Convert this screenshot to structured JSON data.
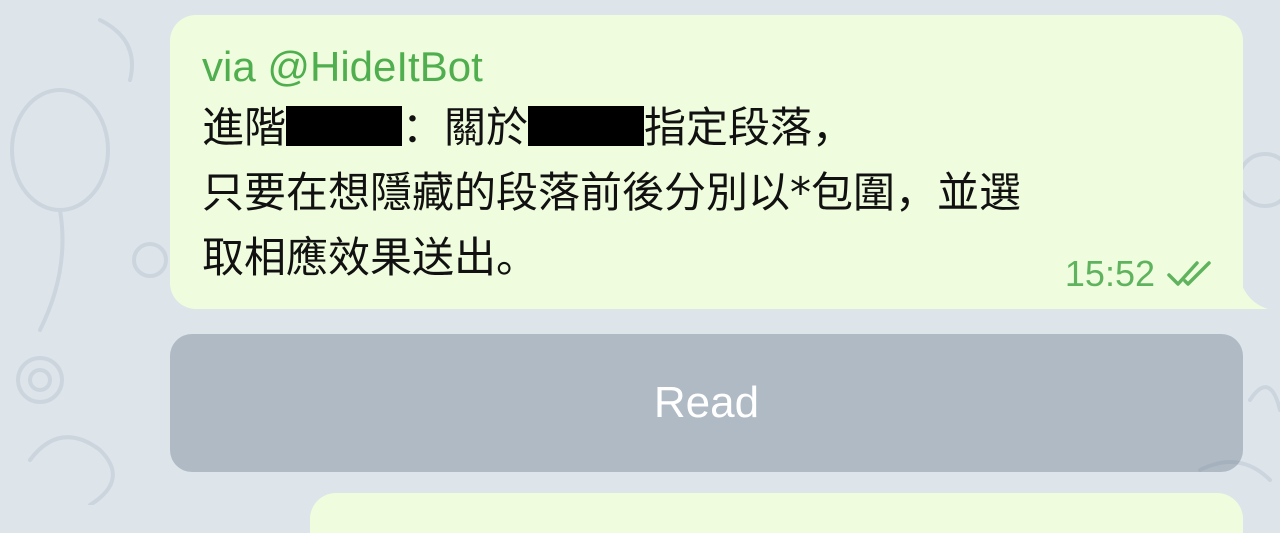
{
  "chat": {
    "message": {
      "via_label": "via @HideItBot",
      "lines": [
        {
          "segments": [
            "進階",
            "：關於",
            "指定段落，"
          ]
        },
        {
          "segments": [
            "只要在想隱藏的段落前後分別以*包圍，並選"
          ]
        },
        {
          "segments": [
            "取相應效果送出。"
          ]
        }
      ],
      "time": "15:52",
      "status_icon": "double-check-icon",
      "colors": {
        "bubble": "#effdde",
        "via": "#4fae4e",
        "time": "#5fb35e"
      }
    },
    "inline_keyboard": {
      "button_label": "Read"
    }
  }
}
